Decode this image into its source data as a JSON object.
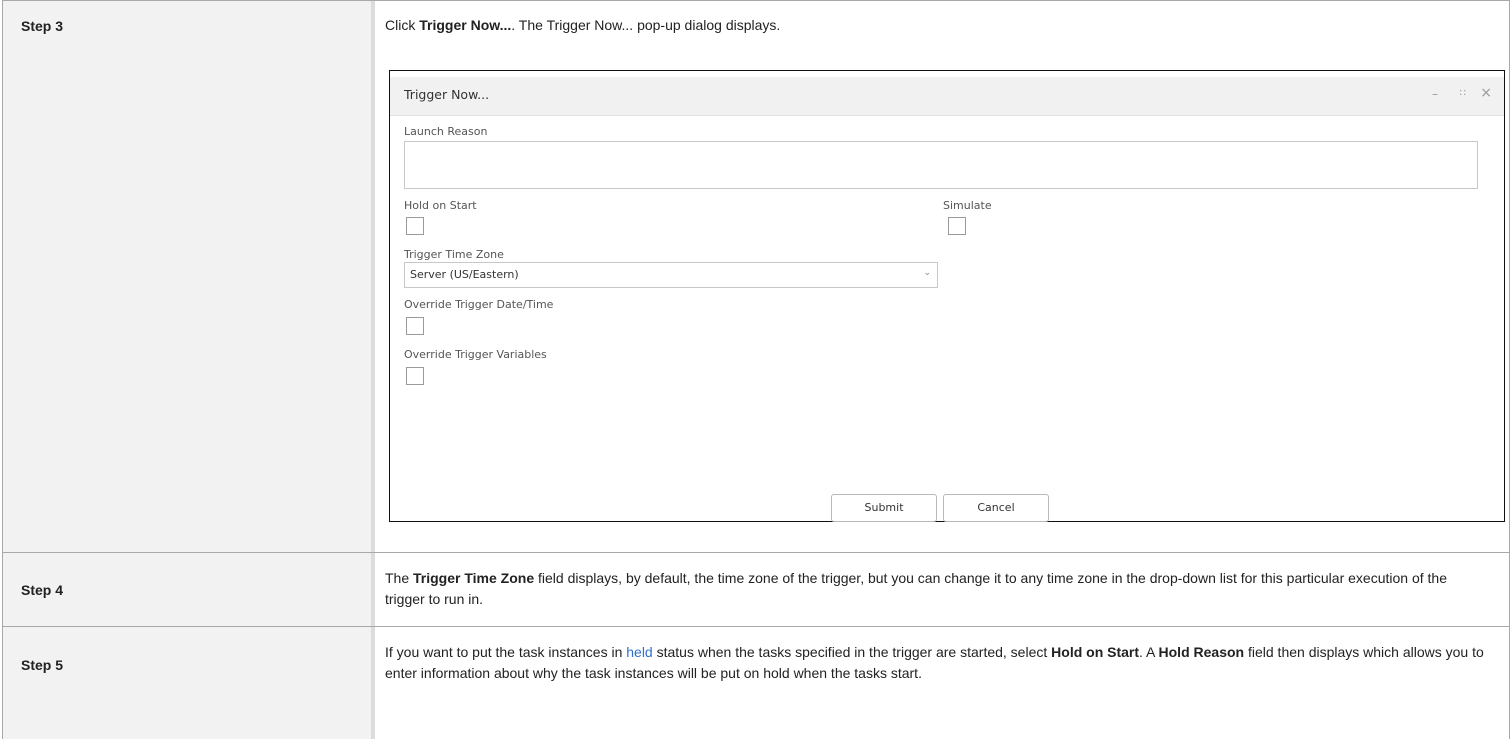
{
  "rows": [
    {
      "step": "Step 3",
      "text": {
        "p1": "Click ",
        "b1": "Trigger Now...",
        "p2": ". The Trigger Now... pop-up dialog displays."
      }
    },
    {
      "step": "Step 4",
      "text": {
        "p1": "The ",
        "b1": "Trigger Time Zone",
        "p2": " field displays, by default, the time zone of the trigger, but you can change it to any time zone in the drop-down list for this particular execution of the trigger to run in."
      }
    },
    {
      "step": "Step 5",
      "text": {
        "p1": "If you want to put the task instances in ",
        "link": "held",
        "p2": " status when the tasks specified in the trigger are started, select ",
        "b1": "Hold on Start",
        "p3": ". A ",
        "b2": "Hold Reason",
        "p4": " field then displays which allows you to enter information about why the task instances will be put on hold when the tasks start."
      }
    }
  ],
  "dialog": {
    "title": "Trigger Now...",
    "controls": {
      "minimize": "–",
      "maximize": "⛶",
      "close": "×"
    },
    "launch_reason_label": "Launch Reason",
    "launch_reason_value": "",
    "hold_on_start_label": "Hold on Start",
    "hold_on_start_checked": false,
    "simulate_label": "Simulate",
    "simulate_checked": false,
    "time_zone_label": "Trigger Time Zone",
    "time_zone_value": "Server (US/Eastern)",
    "override_datetime_label": "Override Trigger Date/Time",
    "override_datetime_checked": false,
    "override_variables_label": "Override Trigger Variables",
    "override_variables_checked": false,
    "submit_label": "Submit",
    "cancel_label": "Cancel"
  }
}
